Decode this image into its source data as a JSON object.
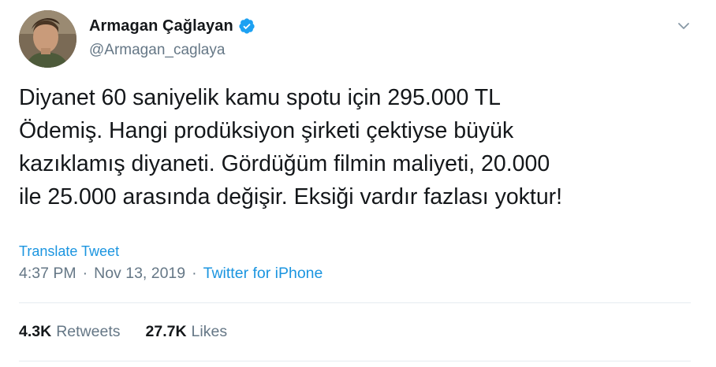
{
  "user": {
    "display_name": "Armagan Çağlayan",
    "handle": "@Armagan_caglaya",
    "verified": true
  },
  "tweet": {
    "text": "Diyanet 60 saniyelik kamu spotu için 295.000 TL\nÖdemiş. Hangi prodüksiyon şirketi çektiyse büyük\nkazıklamış diyaneti. Gördüğüm filmin maliyeti, 20.000\nile 25.000 arasında değişir. Eksiği vardır fazlası yoktur!",
    "translate_label": "Translate Tweet",
    "time": "4:37 PM",
    "date": "Nov 13, 2019",
    "separator": "·",
    "source": "Twitter for iPhone"
  },
  "stats": {
    "retweets_count": "4.3K",
    "retweets_label": "Retweets",
    "likes_count": "27.7K",
    "likes_label": "Likes"
  },
  "icons": {
    "verified": "verified-badge-icon",
    "caret": "chevron-down-icon"
  },
  "colors": {
    "link": "#1b95e0",
    "secondary": "#657786",
    "verified": "#1da1f2",
    "text": "#14171a"
  }
}
